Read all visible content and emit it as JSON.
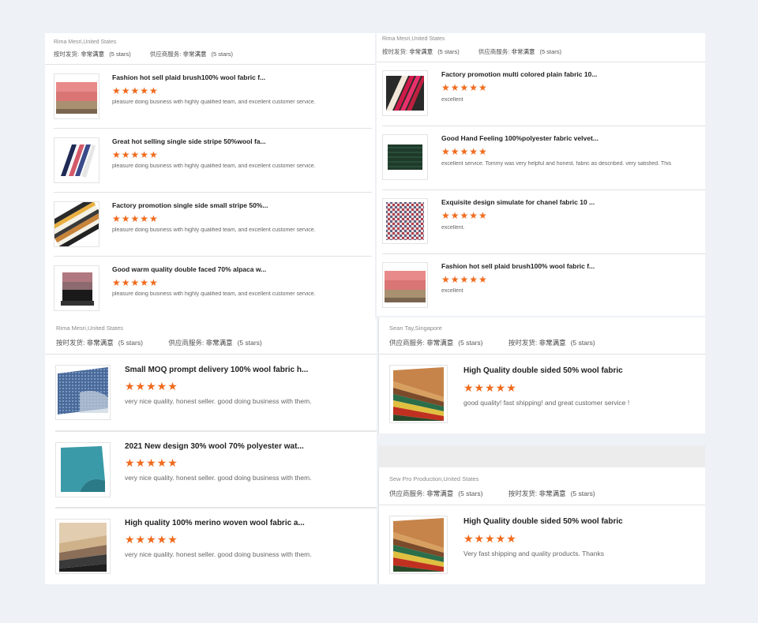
{
  "rating_labels": {
    "ontime": "按时发货:",
    "service": "供应商服务:",
    "value": "非常满意",
    "stars": "(5 stars)"
  },
  "star_glyphs": "★★★★★",
  "colors": {
    "star": "#f06a1c",
    "background": "#eef2f6"
  },
  "panel_a": {
    "reviewer": "Rima Mesri,United States",
    "items": [
      {
        "title": "Fashion hot sell plaid brush100% wool fabric f...",
        "comment": "pleasure doing business with highly qualified team, and excellent customer service."
      },
      {
        "title": "Great hot selling single side stripe 50%wool fa...",
        "comment": "pleasure doing business with highly qualified team, and excellent customer service."
      },
      {
        "title": "Factory promotion single side small stripe 50%...",
        "comment": "pleasure doing business with highly qualified team, and excellent customer service."
      },
      {
        "title": "Good warm quality double faced 70% alpaca w...",
        "comment": "pleasure doing business with highly qualified team, and excellent customer service."
      }
    ]
  },
  "panel_b": {
    "reviewer": "Rima Mesri,United States",
    "items": [
      {
        "title": "Factory promotion multi colored plain fabric 10...",
        "comment": "excellent"
      },
      {
        "title": "Good Hand Feeling 100%polyester fabric velvet...",
        "comment": "excellent service. Tommy was very helpful and honest. fabric as described. very satisfied. This"
      },
      {
        "title": "Exquisite design simulate for chanel fabric 10 ...",
        "comment": "excellent."
      },
      {
        "title": "Fashion hot sell plaid brush100% wool fabric f...",
        "comment": "excellent"
      }
    ]
  },
  "panel_c": {
    "reviewer": "Rima Mesri,United States",
    "items": [
      {
        "title": "Small MOQ prompt delivery 100% wool fabric h...",
        "comment": "very nice quality. honest seller. good doing business with them."
      },
      {
        "title": "2021 New design 30% wool 70% polyester wat...",
        "comment": "very nice quality. honest seller. good doing business with them."
      },
      {
        "title": "High quality 100% merino woven wool fabric a...",
        "comment": "very nice quality. honest seller. good doing business with them."
      }
    ]
  },
  "panel_d": {
    "reviewer": "Sean Tay,Singapore",
    "items": [
      {
        "title": "High Quality double sided 50% wool fabric",
        "comment": "good quality! fast shipping! and great customer service !"
      }
    ]
  },
  "panel_e": {
    "reviewer": "Sew Pro Production,United States",
    "items": [
      {
        "title": "High Quality double sided 50% wool fabric",
        "comment": "Very fast shipping and quality products. Thanks"
      }
    ]
  }
}
